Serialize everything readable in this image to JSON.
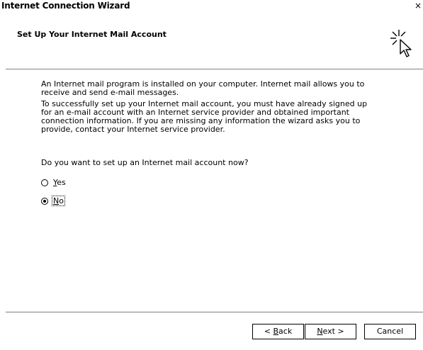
{
  "window": {
    "title": "Internet Connection Wizard",
    "close_glyph": "×"
  },
  "header": {
    "title": "Set Up Your Internet Mail Account",
    "icon": "wizard-cursor-icon"
  },
  "body": {
    "paragraph1": "An Internet mail program is installed on your computer. Internet mail allows you to receive and send e-mail messages.",
    "paragraph2": "To successfully set up your Internet mail account, you must have already signed up for an e-mail account with an Internet service provider and obtained important connection information. If you are missing any information the wizard asks you to provide, contact your Internet service provider.",
    "question": "Do you want to set up an Internet mail account now?"
  },
  "options": {
    "yes": {
      "label_first": "Y",
      "label_rest": "es",
      "selected": false
    },
    "no": {
      "label_first": "N",
      "label_rest": "o",
      "selected": true
    }
  },
  "buttons": {
    "back_prefix": "< ",
    "back_accel": "B",
    "back_rest": "ack",
    "next_accel": "N",
    "next_rest": "ext >",
    "cancel": "Cancel"
  }
}
